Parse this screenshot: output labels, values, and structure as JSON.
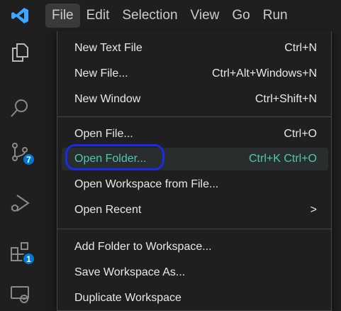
{
  "menubar": {
    "items": [
      {
        "label": "File",
        "active": true
      },
      {
        "label": "Edit"
      },
      {
        "label": "Selection"
      },
      {
        "label": "View"
      },
      {
        "label": "Go"
      },
      {
        "label": "Run"
      }
    ]
  },
  "activity_bar": {
    "icons": [
      "explorer-icon",
      "search-icon",
      "source-control-icon",
      "run-debug-icon",
      "extensions-icon",
      "remote-explorer-icon"
    ],
    "badges": {
      "source_control": "7",
      "extensions": "1"
    }
  },
  "file_menu": {
    "groups": [
      [
        {
          "label": "New Text File",
          "shortcut": "Ctrl+N"
        },
        {
          "label": "New File...",
          "shortcut": "Ctrl+Alt+Windows+N"
        },
        {
          "label": "New Window",
          "shortcut": "Ctrl+Shift+N"
        }
      ],
      [
        {
          "label": "Open File...",
          "shortcut": "Ctrl+O"
        },
        {
          "label": "Open Folder...",
          "shortcut": "Ctrl+K Ctrl+O",
          "highlighted": true
        },
        {
          "label": "Open Workspace from File...",
          "shortcut": ""
        },
        {
          "label": "Open Recent",
          "shortcut": ">"
        }
      ],
      [
        {
          "label": "Add Folder to Workspace...",
          "shortcut": ""
        },
        {
          "label": "Save Workspace As...",
          "shortcut": ""
        },
        {
          "label": "Duplicate Workspace",
          "shortcut": ""
        }
      ]
    ]
  },
  "colors": {
    "accent": "#0078d4",
    "highlight_text": "#4ec9b0",
    "annotation": "#1a2be8",
    "logo": "#3ea6ff"
  }
}
